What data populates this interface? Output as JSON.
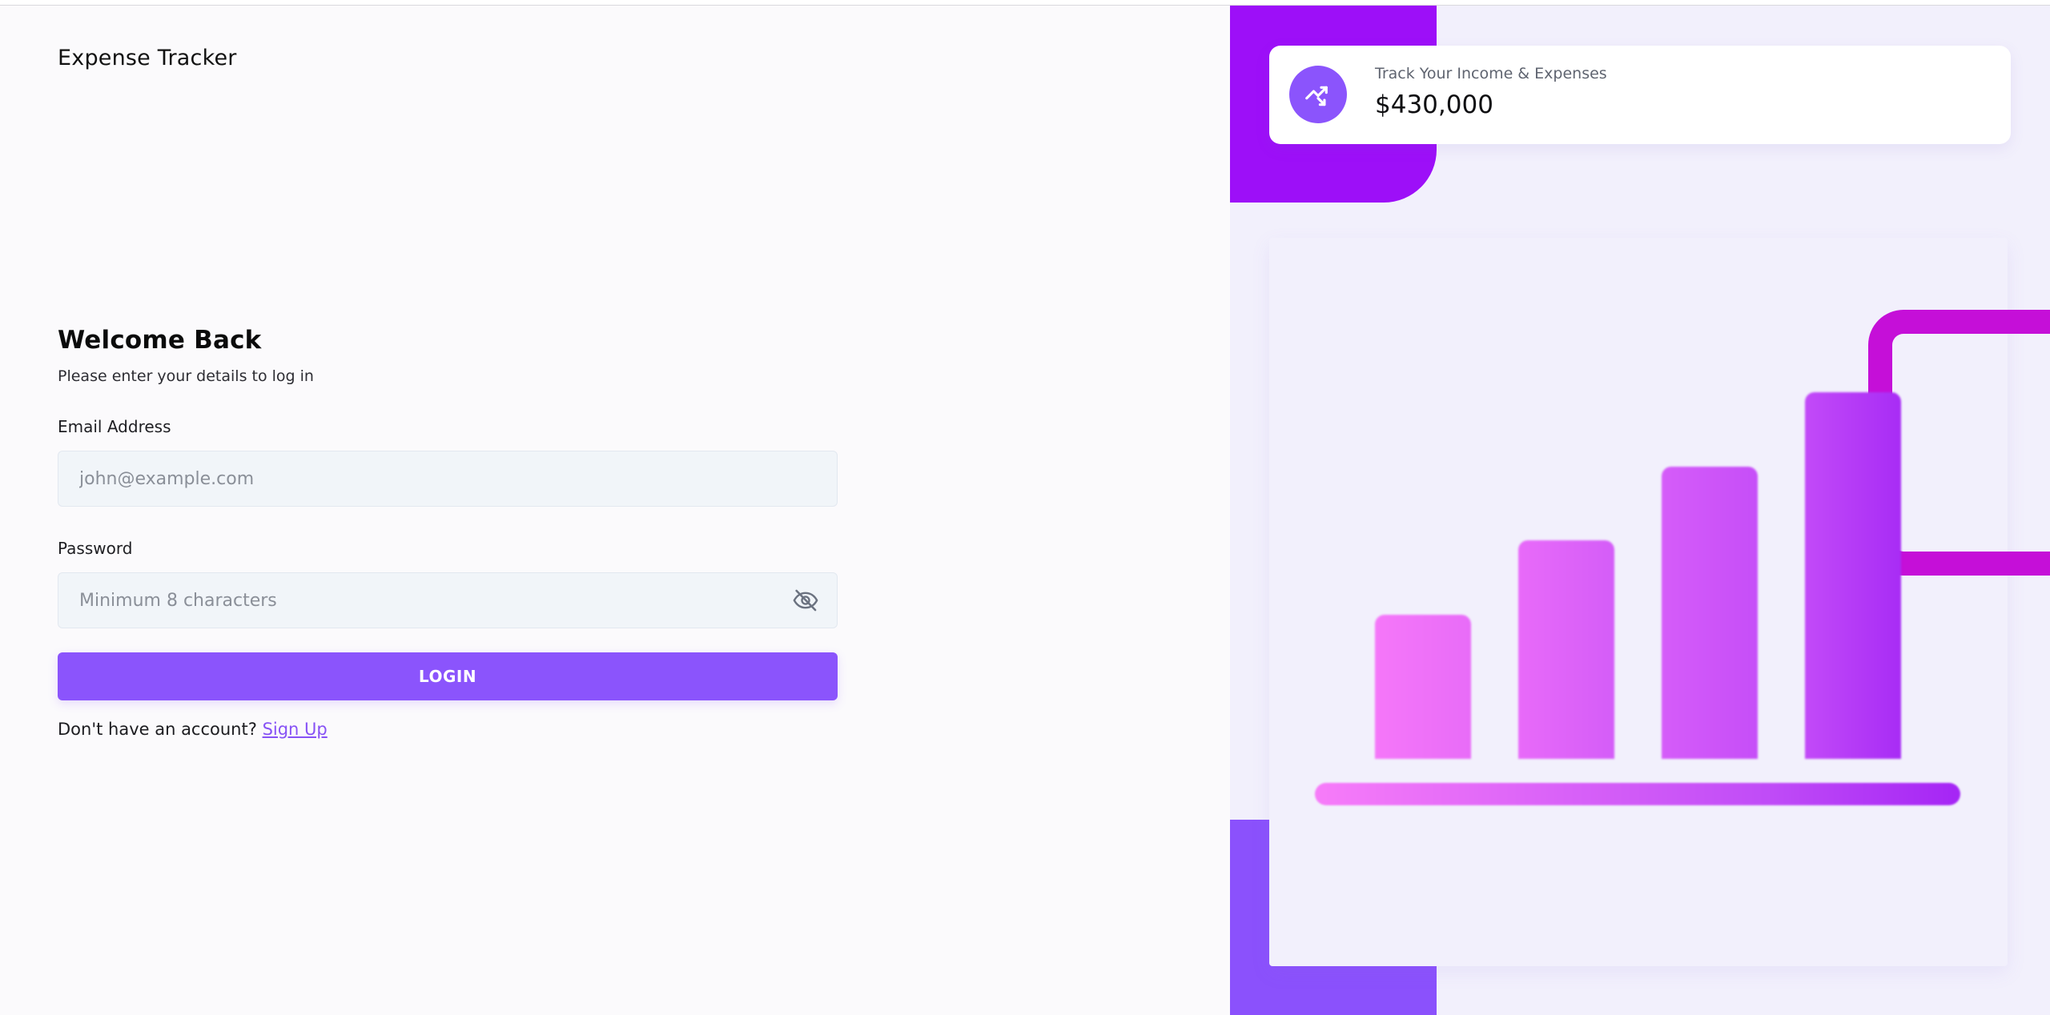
{
  "app": {
    "title": "Expense Tracker"
  },
  "login": {
    "heading": "Welcome Back",
    "subheading": "Please enter your details to log in",
    "email_label": "Email Address",
    "email_placeholder": "john@example.com",
    "email_value": "",
    "password_label": "Password",
    "password_placeholder": "Minimum 8 characters",
    "password_value": "",
    "login_button": "LOGIN",
    "signup_prompt": "Don't have an account?",
    "signup_link": "Sign Up"
  },
  "stat_card": {
    "label": "Track Your Income & Expenses",
    "value": "$430,000",
    "icon": "trending-up-icon"
  },
  "illustration": {
    "bar_levels": [
      0.33,
      0.5,
      0.67,
      0.84
    ],
    "bar_colors": [
      [
        "#f577f9",
        "#e86cf8"
      ],
      [
        "#e86af9",
        "#d45df8"
      ],
      [
        "#d55cf9",
        "#c64ef8"
      ],
      [
        "#c24af8",
        "#a82cf5"
      ]
    ]
  },
  "colors": {
    "accent": "#8b54fc",
    "accent_dark": "#9d0ff8",
    "magenta": "#c50fd8",
    "link": "#8752f5"
  }
}
